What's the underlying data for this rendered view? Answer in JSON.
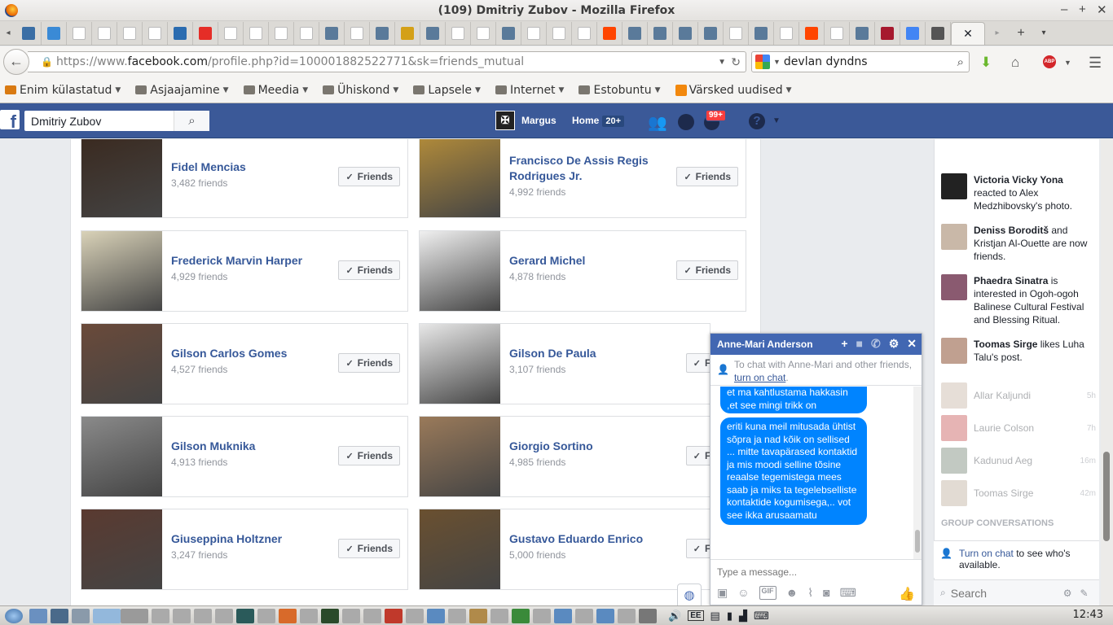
{
  "window": {
    "title": "(109) Dmitriy Zubov - Mozilla Firefox"
  },
  "tabs": [
    {
      "icon": "grid-app-icon"
    },
    {
      "icon": "layout-icon"
    },
    {
      "icon": "blank-icon"
    },
    {
      "icon": "blank-icon"
    },
    {
      "icon": "blank-icon"
    },
    {
      "icon": "blank-icon"
    },
    {
      "icon": "chart-icon"
    },
    {
      "icon": "youtube-icon"
    },
    {
      "icon": "blank-icon"
    },
    {
      "icon": "blank-icon"
    },
    {
      "icon": "blank-icon"
    },
    {
      "icon": "blank-icon"
    },
    {
      "icon": "figure-icon"
    },
    {
      "icon": "blank-icon"
    },
    {
      "icon": "figure-icon"
    },
    {
      "icon": "wings-icon"
    },
    {
      "icon": "figure-icon"
    },
    {
      "icon": "blank-icon"
    },
    {
      "icon": "blank-icon"
    },
    {
      "icon": "figure-icon"
    },
    {
      "icon": "blank-icon"
    },
    {
      "icon": "blank-icon"
    },
    {
      "icon": "blank-icon"
    },
    {
      "icon": "reddit-icon"
    },
    {
      "icon": "figure-icon"
    },
    {
      "icon": "figure-icon"
    },
    {
      "icon": "figure-icon"
    },
    {
      "icon": "figure-icon"
    },
    {
      "icon": "blank-icon"
    },
    {
      "icon": "figure-icon"
    },
    {
      "icon": "blank-icon"
    },
    {
      "icon": "reddit-icon"
    },
    {
      "icon": "blank-icon"
    },
    {
      "icon": "figure-icon"
    },
    {
      "icon": "s-icon"
    },
    {
      "icon": "google-icon"
    },
    {
      "icon": "pocket-icon"
    }
  ],
  "active_tab": {
    "close_glyph": "✕"
  },
  "url": {
    "prefix": "https://www.",
    "domain": "facebook.com",
    "path": "/profile.php?id=100001882522771&sk=friends_mutual"
  },
  "search": {
    "value": "devlan dyndns"
  },
  "bookmarks": [
    {
      "label": "Enim külastatud",
      "icon": "folder-icon-orange"
    },
    {
      "label": "Asjaajamine",
      "icon": "folder-icon"
    },
    {
      "label": "Meedia",
      "icon": "folder-icon"
    },
    {
      "label": "Ühiskond",
      "icon": "folder-icon"
    },
    {
      "label": "Lapsele",
      "icon": "folder-icon"
    },
    {
      "label": "Internet",
      "icon": "folder-icon"
    },
    {
      "label": "Estobuntu",
      "icon": "folder-icon"
    },
    {
      "label": "Värsked uudised",
      "icon": "rss-icon"
    }
  ],
  "fb": {
    "search_value": "Dmitriy Zubov",
    "user_name": "Margus",
    "home_label": "Home",
    "home_count": "20+",
    "notif_count": "99+"
  },
  "friends": [
    {
      "name": "Fidel Mencias",
      "count": "3,482 friends",
      "button": "Friends",
      "avatar_color": "#3a2a20"
    },
    {
      "name": "Francisco De Assis Regis Rodrigues Jr.",
      "count": "4,992 friends",
      "button": "Friends",
      "avatar_color": "#b08a3a"
    },
    {
      "name": "Frederick Marvin Harper",
      "count": "4,929 friends",
      "button": "Friends",
      "avatar_color": "#d9d2b8"
    },
    {
      "name": "Gerard Michel",
      "count": "4,878 friends",
      "button": "Friends",
      "avatar_color": "#f0f0f0"
    },
    {
      "name": "Gilson Carlos Gomes",
      "count": "4,527 friends",
      "button": "Friends",
      "avatar_color": "#6a4a3a"
    },
    {
      "name": "Gilson De Paula",
      "count": "3,107 friends",
      "button": "Frie",
      "avatar_color": "#e8e8e8"
    },
    {
      "name": "Gilson Muknika",
      "count": "4,913 friends",
      "button": "Friends",
      "avatar_color": "#8a8a8a"
    },
    {
      "name": "Giorgio Sortino",
      "count": "4,985 friends",
      "button": "Frie",
      "avatar_color": "#9a7a5a"
    },
    {
      "name": "Giuseppina Holtzner",
      "count": "3,247 friends",
      "button": "Friends",
      "avatar_color": "#5a3a30"
    },
    {
      "name": "Gustavo Eduardo Enrico",
      "count": "5,000 friends",
      "button": "Frie",
      "avatar_color": "#6a5030"
    }
  ],
  "ticker": [
    {
      "bold": "Victoria Vicky Yona",
      "rest": " reacted to Alex Medzhibovsky's photo.",
      "avatar_color": "#222"
    },
    {
      "bold": "Deniss Boroditš",
      "rest": " and Kristjan Al-Ouette are now friends.",
      "avatar_color": "#c9b8a8"
    },
    {
      "bold": "Phaedra Sinatra",
      "rest": " is interested in Ogoh-ogoh Balinese Cultural Festival and Blessing Ritual.",
      "avatar_color": "#8a5a70"
    },
    {
      "bold": "Toomas Sirge",
      "rest": " likes Luha Talu's post.",
      "avatar_color": "#c0a090"
    }
  ],
  "contacts": [
    {
      "name": "Allar Kaljundi",
      "time": "5h",
      "avatar_color": "#c8b8a8"
    },
    {
      "name": "Laurie Colson",
      "time": "7h",
      "avatar_color": "#c85a5a"
    },
    {
      "name": "Kadunud Aeg",
      "time": "16m",
      "avatar_color": "#7a8a7a"
    },
    {
      "name": "Toomas Sirge",
      "time": "42m",
      "avatar_color": "#c0b0a0"
    }
  ],
  "group_conversations": "GROUP CONVERSATIONS",
  "turn_on": {
    "link": "Turn on chat",
    "rest": " to see who's available."
  },
  "sidebar_search_placeholder": "Search",
  "chat": {
    "name": "Anne-Mari Anderson",
    "notice_pre": "To chat with Anne-Mari and other friends, ",
    "notice_link": "turn on chat",
    "notice_post": ".",
    "msg1": "et ma kahtlustama hakkasin ,et see mingi trikk on",
    "msg2": "eriti kuna meil mitusada ühtist sõpra ja nad kõik on sellised ... mitte tavapärased kontaktid ja mis moodi selline tõsine reaalse tegemistega mees saab ja miks ta tegelebselliste kontaktide kogumisega,.. vot see ikka arusaamatu",
    "placeholder": "Type a message..."
  },
  "clock": "12:43"
}
